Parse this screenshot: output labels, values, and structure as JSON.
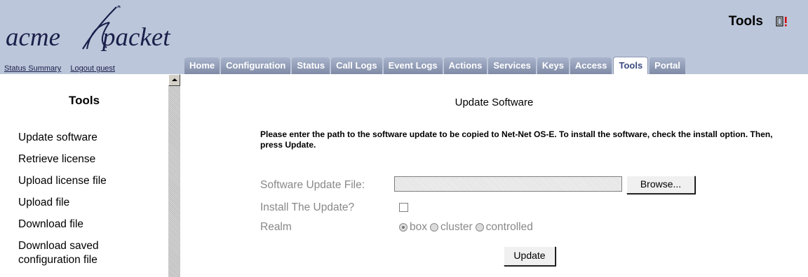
{
  "header": {
    "logo": {
      "word1": "acme",
      "word2": "packet"
    },
    "links": {
      "status_summary": "Status Summary",
      "logout": "Logout guest"
    },
    "title": "Tools"
  },
  "tabs": [
    {
      "label": "Home",
      "active": false
    },
    {
      "label": "Configuration",
      "active": false
    },
    {
      "label": "Status",
      "active": false
    },
    {
      "label": "Call Logs",
      "active": false
    },
    {
      "label": "Event Logs",
      "active": false
    },
    {
      "label": "Actions",
      "active": false
    },
    {
      "label": "Services",
      "active": false
    },
    {
      "label": "Keys",
      "active": false
    },
    {
      "label": "Access",
      "active": false
    },
    {
      "label": "Tools",
      "active": true
    },
    {
      "label": "Portal",
      "active": false
    }
  ],
  "sidebar": {
    "title": "Tools",
    "items": [
      "Update software",
      "Retrieve license",
      "Upload license file",
      "Upload file",
      "Download file",
      "Download saved configuration file"
    ]
  },
  "main": {
    "page_title": "Update Software",
    "instructions": "Please enter the path to the software update to be copied to Net-Net OS-E. To install the software, check the install option. Then, press Update.",
    "file_label": "Software Update File:",
    "file_value": "",
    "browse_label": "Browse...",
    "install_label": "Install The Update?",
    "install_checked": false,
    "realm_label": "Realm",
    "realm_options": [
      "box",
      "cluster",
      "controlled"
    ],
    "realm_selected": "box",
    "update_label": "Update"
  },
  "colors": {
    "header_bg": "#bcc6da",
    "tab_text": "#ffffff",
    "active_tab_text": "#3a4a80",
    "logo_color": "#1a1f4a"
  }
}
